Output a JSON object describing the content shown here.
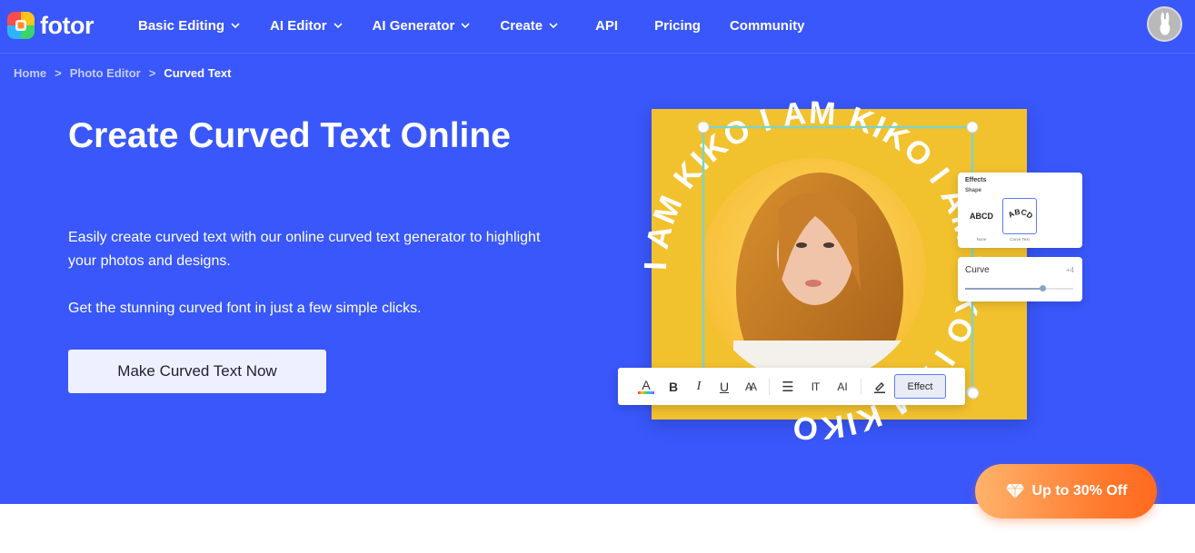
{
  "brand": {
    "name": "fotor"
  },
  "nav": {
    "items": [
      {
        "label": "Basic Editing",
        "dropdown": true
      },
      {
        "label": "AI Editor",
        "dropdown": true
      },
      {
        "label": "AI Generator",
        "dropdown": true
      },
      {
        "label": "Create",
        "dropdown": true
      },
      {
        "label": "API",
        "dropdown": false
      },
      {
        "label": "Pricing",
        "dropdown": false
      },
      {
        "label": "Community",
        "dropdown": false
      }
    ]
  },
  "breadcrumb": {
    "items": [
      "Home",
      "Photo Editor",
      "Curved Text"
    ],
    "separator": ">"
  },
  "hero": {
    "title": "Create Curved Text Online",
    "description": "Easily create curved text with our online curved text generator to highlight your photos and designs.",
    "description2": "Get the stunning curved font in just a few simple clicks.",
    "cta_label": "Make Curved Text Now"
  },
  "demo": {
    "curved_text": "I AM KIKO I AM KIKO I AM KIKO I AM KIKO",
    "effects_panel": {
      "title": "Effects",
      "shape_label": "Shape",
      "options": [
        {
          "text": "ABCD",
          "caption": "None"
        },
        {
          "text": "ABCD",
          "caption": "Curve Text"
        }
      ]
    },
    "curve_panel": {
      "label": "Curve",
      "value": "+4",
      "level": 0.72
    },
    "toolbar": {
      "text_color_glyph": "A",
      "bold_glyph": "B",
      "italic_glyph": "I",
      "underline_glyph": "U",
      "case_glyph": "AA",
      "align_glyph": "☰",
      "spacing_glyph": "IT",
      "ai_glyph": "AI",
      "effect_label": "Effect"
    },
    "colors": {
      "card": "#f2c12e",
      "frame": "#7fd3c4",
      "accent": "#5d79ff"
    }
  },
  "promo": {
    "label": "Up to 30% Off"
  },
  "colors": {
    "hero_bg": "#3957fb",
    "cta_bg": "#eef0ff",
    "promo_start": "#ffb36b",
    "promo_end": "#ff6a1f"
  }
}
